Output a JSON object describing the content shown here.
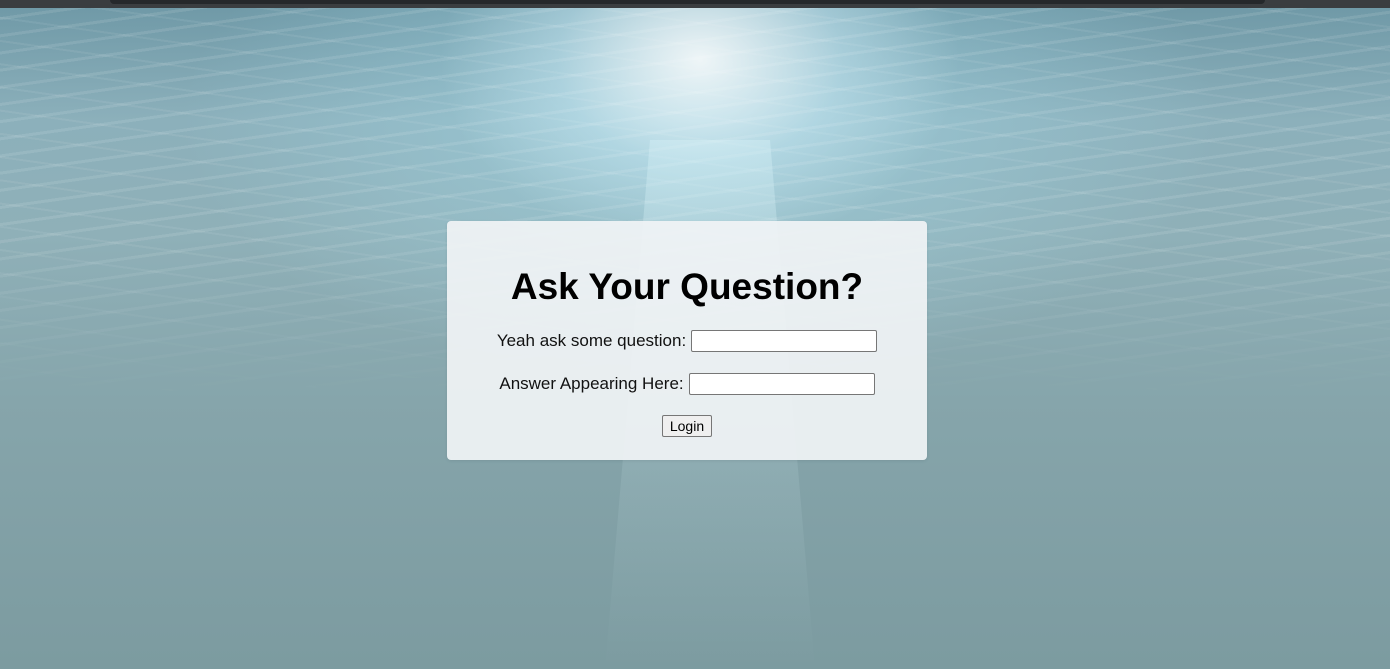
{
  "form": {
    "title": "Ask Your Question?",
    "question_label": "Yeah ask some question:",
    "question_value": "",
    "answer_label": "Answer Appearing Here:",
    "answer_value": "",
    "submit_label": "Login"
  },
  "colors": {
    "card_background": "#f0f3f5",
    "water_top": "#6e98a6",
    "water_bottom": "#7c9ba0"
  }
}
